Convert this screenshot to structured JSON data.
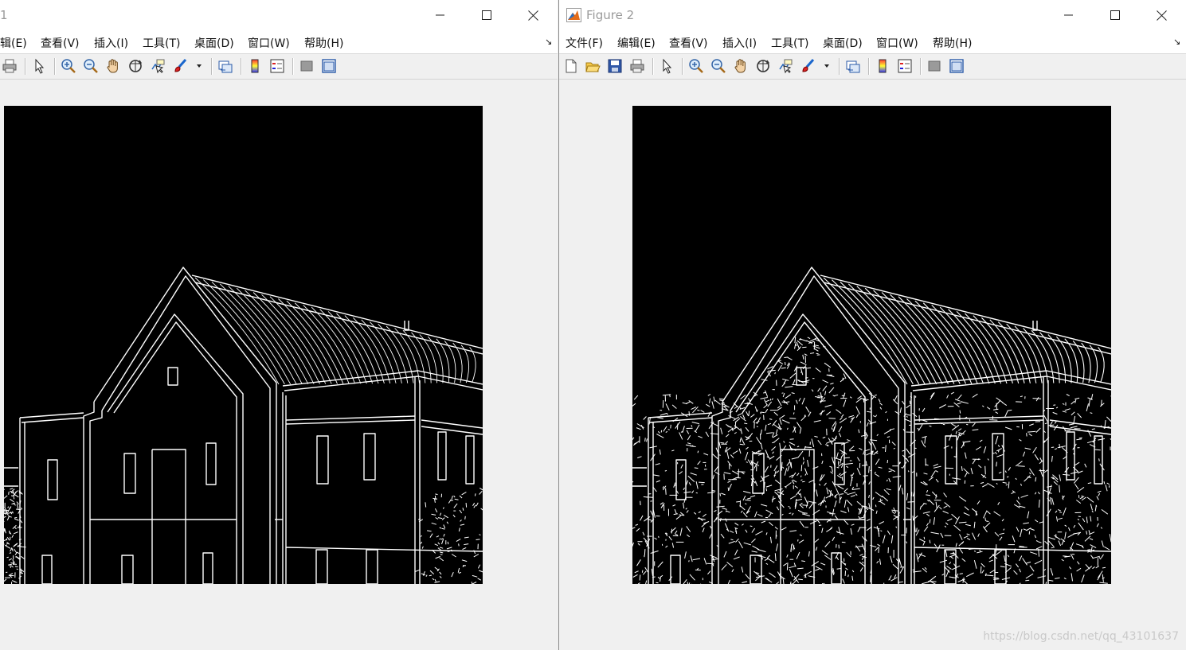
{
  "window1": {
    "title": "1",
    "menu": [
      "辑(E)",
      "查看(V)",
      "插入(I)",
      "工具(T)",
      "桌面(D)",
      "窗口(W)",
      "帮助(H)"
    ],
    "toolbar_icons": [
      "print-icon",
      "pointer-icon",
      "zoom-in-icon",
      "zoom-out-icon",
      "pan-hand-icon",
      "rotate-3d-icon",
      "data-cursor-icon",
      "brush-icon",
      "brush-dropdown-icon",
      "link-plot-icon",
      "colorbar-icon",
      "legend-icon",
      "hide-plot-tools-icon",
      "show-plot-tools-icon"
    ]
  },
  "window2": {
    "title": "Figure 2",
    "menu": [
      "文件(F)",
      "编辑(E)",
      "查看(V)",
      "插入(I)",
      "工具(T)",
      "桌面(D)",
      "窗口(W)",
      "帮助(H)"
    ],
    "toolbar_icons": [
      "new-figure-icon",
      "open-file-icon",
      "save-icon",
      "print-icon",
      "pointer-icon",
      "zoom-in-icon",
      "zoom-out-icon",
      "pan-hand-icon",
      "rotate-3d-icon",
      "data-cursor-icon",
      "brush-icon",
      "brush-dropdown-icon",
      "link-plot-icon",
      "colorbar-icon",
      "legend-icon",
      "hide-plot-tools-icon",
      "show-plot-tools-icon"
    ]
  },
  "image_content": "edge-detection-result-of-building",
  "colors": {
    "axes_background": "#000000",
    "edges": "#ffffff",
    "figure_background": "#f0f0f0"
  },
  "watermark": "https://blog.csdn.net/qq_43101637"
}
